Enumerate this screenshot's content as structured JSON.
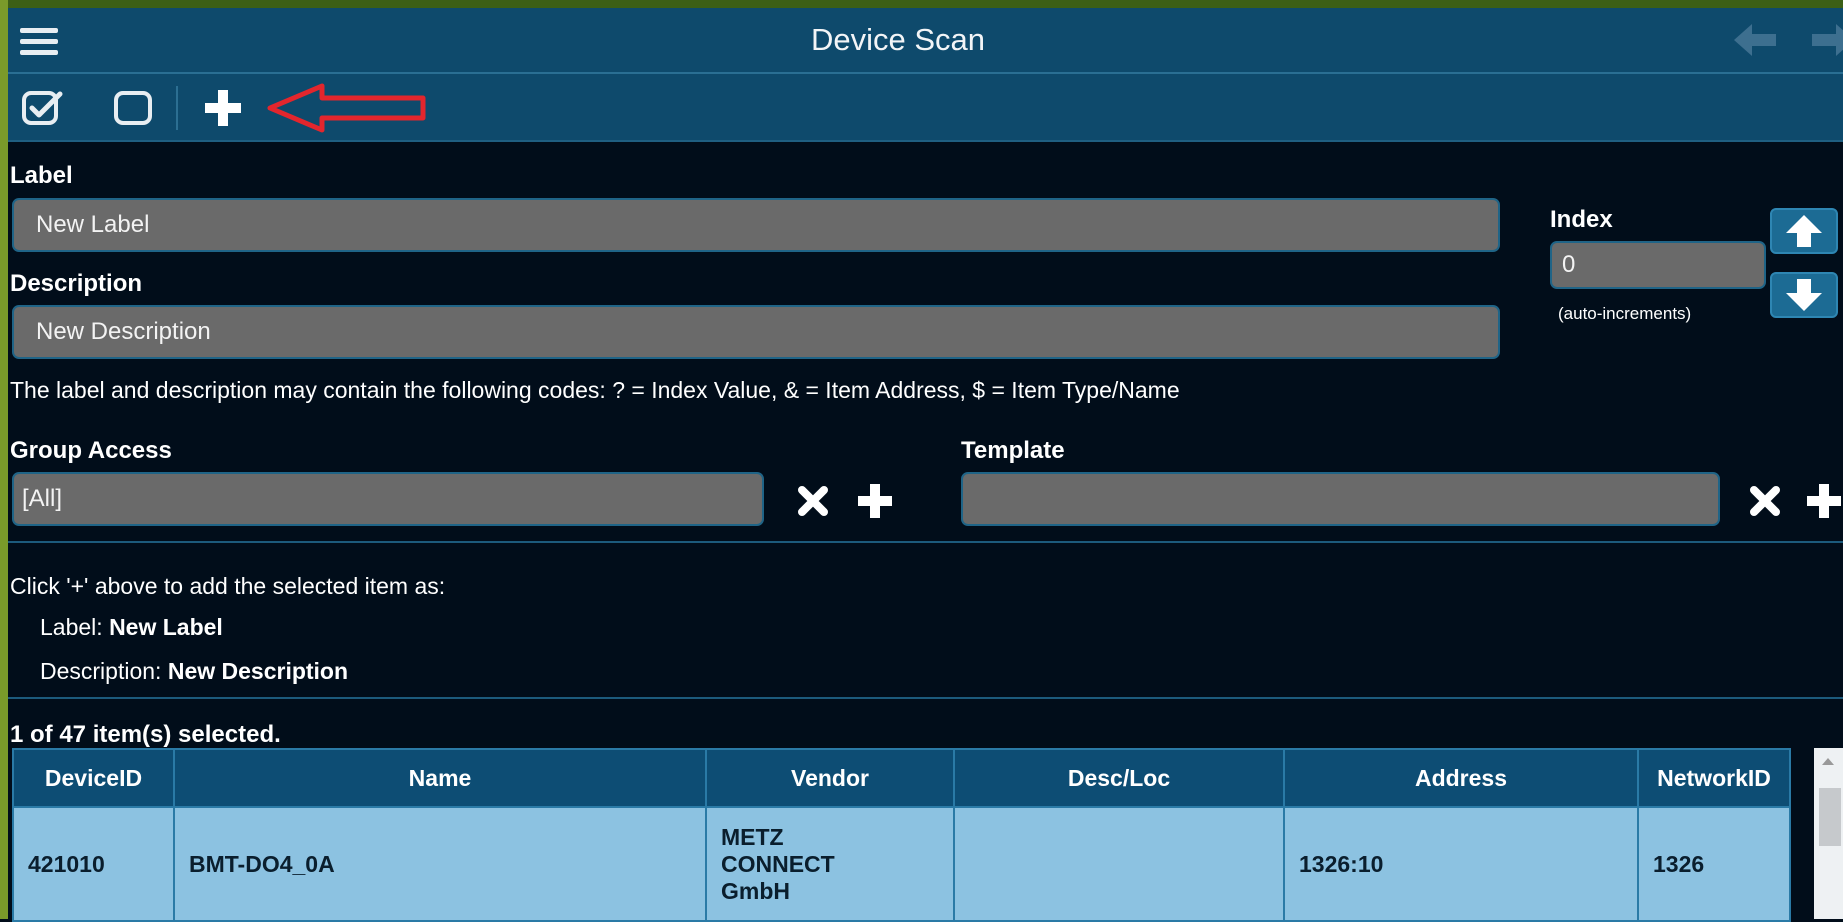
{
  "header": {
    "title": "Device Scan"
  },
  "form": {
    "label_heading": "Label",
    "label_value": "New Label",
    "description_heading": "Description",
    "description_value": "New Description",
    "index_heading": "Index",
    "index_value": "0",
    "index_hint": "(auto-increments)",
    "codes_hint": "The label and description may contain the following codes: ? = Index Value, & = Item Address, $ = Item Type/Name",
    "group_access_heading": "Group Access",
    "group_access_value": "[All]",
    "template_heading": "Template",
    "template_value": ""
  },
  "summary": {
    "intro": "Click '+' above to add the selected item as:",
    "label_key": "Label:",
    "label_value": "New Label",
    "description_key": "Description:",
    "description_value": "New Description",
    "selection_status": "1 of 47 item(s) selected."
  },
  "table": {
    "columns": [
      "DeviceID",
      "Name",
      "Vendor",
      "Desc/Loc",
      "Address",
      "NetworkID"
    ],
    "rows": [
      {
        "device_id": "421010",
        "name": "BMT-DO4_0A",
        "vendor": "METZ\nCONNECT\nGmbH",
        "desc_loc": "",
        "address": "1326:10",
        "network_id": "1326"
      }
    ]
  },
  "colors": {
    "header_bg": "#0e4a6c",
    "page_bg": "#010d1a",
    "input_bg": "#6a6a6a",
    "selected_row_bg": "#8cc2e1",
    "annotation_arrow": "#e3262d"
  },
  "icons": {
    "menu": "hamburger-menu-icon",
    "back": "arrow-left-icon",
    "forward": "arrow-right-icon",
    "select_all": "checkbox-checked-icon",
    "select_none": "checkbox-empty-icon",
    "add": "plus-icon",
    "clear": "close-icon",
    "index_up": "arrow-up-icon",
    "index_down": "arrow-down-icon"
  }
}
